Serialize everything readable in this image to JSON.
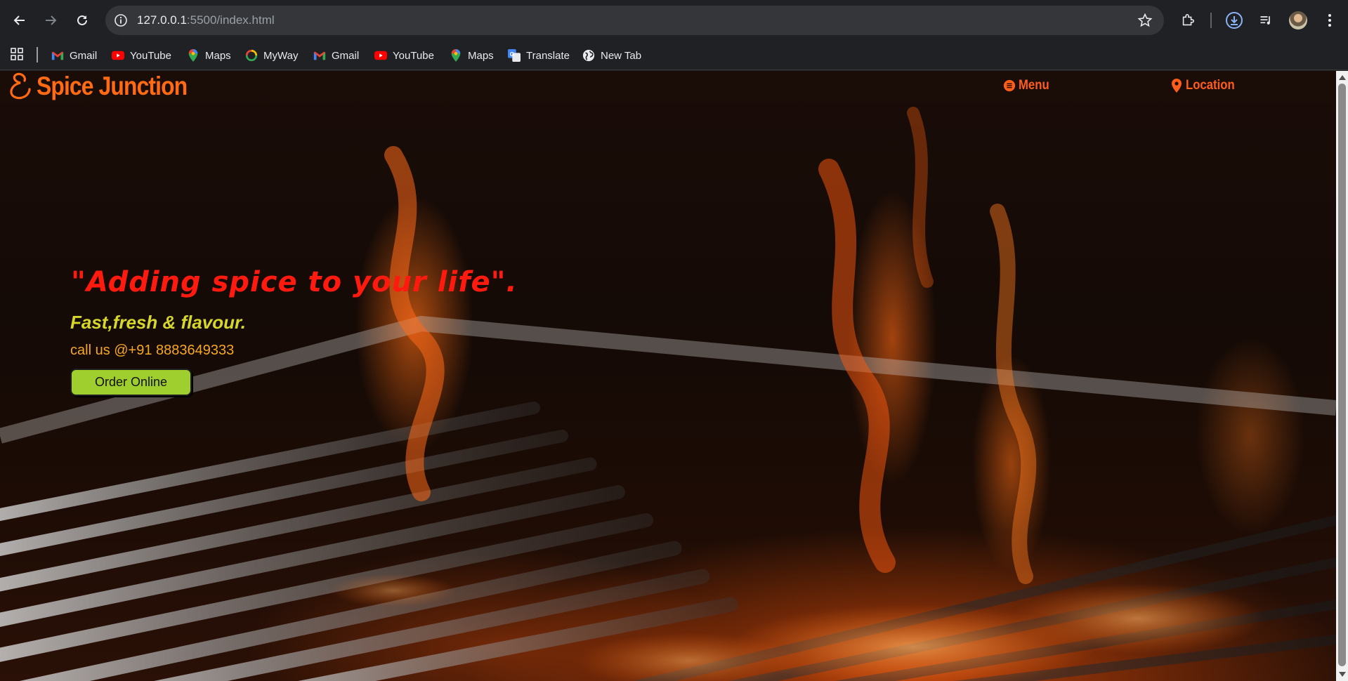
{
  "browser": {
    "url_host": "127.0.0.1",
    "url_rest": ":5500/index.html",
    "colors": {
      "chrome_bg": "#202124",
      "omnibox_bg": "#35363a",
      "text": "#e8eaed"
    }
  },
  "bookmarks": [
    {
      "label": "Gmail",
      "icon": "gmail-icon"
    },
    {
      "label": "YouTube",
      "icon": "youtube-icon"
    },
    {
      "label": "Maps",
      "icon": "maps-icon"
    },
    {
      "label": "MyWay",
      "icon": "myway-icon"
    },
    {
      "label": "Gmail",
      "icon": "gmail-icon"
    },
    {
      "label": "YouTube",
      "icon": "youtube-icon"
    },
    {
      "label": "Maps",
      "icon": "maps-icon"
    },
    {
      "label": "Translate",
      "icon": "translate-icon"
    },
    {
      "label": "New Tab",
      "icon": "globe-icon"
    }
  ],
  "site": {
    "brand": "Spice Junction",
    "nav": {
      "menu": "Menu",
      "location": "Location"
    },
    "tagline": "\"Adding spice to your life\".",
    "subtagline": "Fast,fresh & flavour.",
    "phone": "call us @+91 8883649333",
    "cta": "Order Online",
    "colors": {
      "brand": "#ff6a13",
      "nav": "#ff5d1a",
      "tagline": "#ff1a10",
      "subtagline": "#d6d72a",
      "phone": "#f6a81e",
      "cta_bg": "#9fcf2e"
    }
  }
}
